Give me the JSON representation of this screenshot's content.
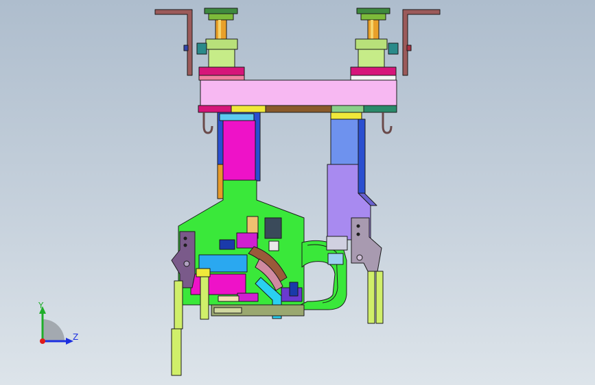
{
  "triad": {
    "y_label": "Y",
    "z_label": "Z",
    "colors": {
      "y": "#1fae2a",
      "z": "#1c2fe0",
      "x": "#e01b1b"
    }
  },
  "model": {
    "icon": "mechanical-gripper-fixture-icon"
  }
}
